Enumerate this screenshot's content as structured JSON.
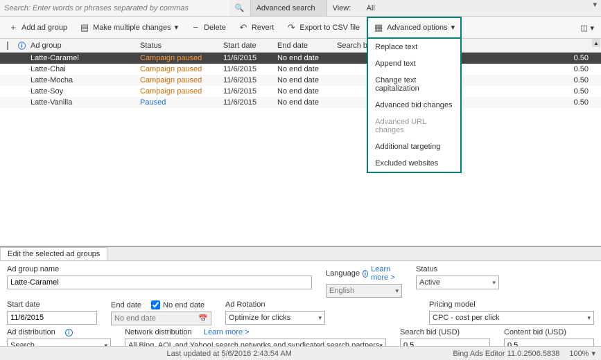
{
  "top": {
    "search_placeholder": "Search: Enter words or phrases separated by commas",
    "advanced_search": "Advanced search",
    "view_label": "View:",
    "view_value": "All"
  },
  "toolbar": {
    "add": "Add ad group",
    "multi": "Make multiple changes",
    "delete": "Delete",
    "revert": "Revert",
    "export": "Export to CSV file",
    "advanced": "Advanced options"
  },
  "adv_menu": {
    "replace": "Replace text",
    "append": "Append text",
    "cap": "Change text capitalization",
    "bid": "Advanced bid changes",
    "url": "Advanced URL changes",
    "target": "Additional targeting",
    "excl": "Excluded websites"
  },
  "grid": {
    "head": {
      "adg": "Ad group",
      "stat": "Status",
      "sd": "Start date",
      "ed": "End date",
      "sb": "Search bid (USD)"
    },
    "rows": [
      {
        "adg": "Latte-Caramel",
        "stat": "Campaign paused",
        "sd": "11/6/2015",
        "ed": "No end date",
        "sb": "0.50"
      },
      {
        "adg": "Latte-Chai",
        "stat": "Campaign paused",
        "sd": "11/6/2015",
        "ed": "No end date",
        "sb": "0.50"
      },
      {
        "adg": "Latte-Mocha",
        "stat": "Campaign paused",
        "sd": "11/6/2015",
        "ed": "No end date",
        "sb": "0.50"
      },
      {
        "adg": "Latte-Soy",
        "stat": "Campaign paused",
        "sd": "11/6/2015",
        "ed": "No end date",
        "sb": "0.50"
      },
      {
        "adg": "Latte-Vanilla",
        "stat": "Paused",
        "sd": "11/6/2015",
        "ed": "No end date",
        "sb": "0.50"
      }
    ]
  },
  "edit": {
    "tab": "Edit the selected ad groups",
    "name_lbl": "Ad group name",
    "name_val": "Latte-Caramel",
    "lang_lbl": "Language",
    "lang_val": "English",
    "learn_more": "Learn more >",
    "status_lbl": "Status",
    "status_val": "Active",
    "sd_lbl": "Start date",
    "sd_val": "11/6/2015",
    "ed_lbl": "End date",
    "ed_cb": "No end date",
    "ed_val": "No end date",
    "rot_lbl": "Ad Rotation",
    "rot_val": "Optimize for clicks",
    "price_lbl": "Pricing model",
    "price_val": "CPC - cost per click",
    "dist_lbl": "Ad distribution",
    "dist_val": "Search",
    "net_lbl": "Network distribution",
    "net_val": "All Bing, AOL and Yahoo! search networks and syndicated search partners",
    "sbid_lbl": "Search bid (USD)",
    "sbid_val": "0.5",
    "cbid_lbl": "Content bid (USD)",
    "cbid_val": "0.5"
  },
  "status": {
    "updated": "Last updated at 5/6/2016 2:43:54 AM",
    "app": "Bing Ads Editor 11.0.2506.5838",
    "zoom": "100%"
  }
}
